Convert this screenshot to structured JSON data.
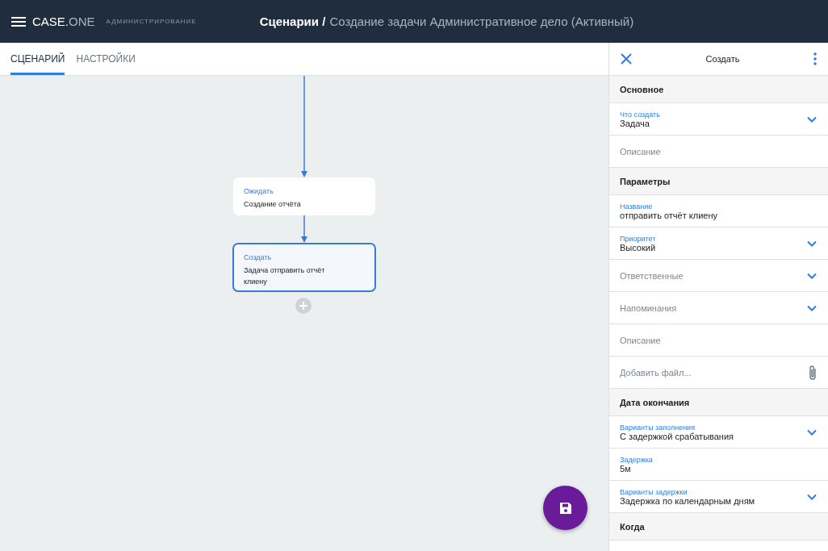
{
  "app_bar": {
    "logo_bold": "CASE.",
    "logo_light": "ONE",
    "subtitle": "АДМИНИСТРИРОВАНИЕ",
    "breadcrumb": "Сценарии /",
    "title": "Создание задачи Административное дело (Активный)"
  },
  "tabs": [
    {
      "label": "СЦЕНАРИЙ",
      "selected": true
    },
    {
      "label": "НАСТРОЙКИ",
      "selected": false
    }
  ],
  "flow": {
    "nodes": [
      {
        "type": "Ожидать",
        "text": "Создание отчёта",
        "selected": false
      },
      {
        "type": "Создать",
        "text": "Задача отправить отчёт клиену",
        "selected": true
      }
    ]
  },
  "panel": {
    "title": "Создать",
    "rows": [
      {
        "kind": "section",
        "label": "Основное"
      },
      {
        "kind": "select",
        "label": "Что создать",
        "value": "Задача"
      },
      {
        "kind": "input",
        "placeholder": "Описание"
      },
      {
        "kind": "section",
        "label": "Параметры"
      },
      {
        "kind": "input",
        "label": "Название",
        "value": "отправить отчёт клиену"
      },
      {
        "kind": "select",
        "label": "Приоритет",
        "value": "Высокий"
      },
      {
        "kind": "select",
        "placeholder": "Ответственные"
      },
      {
        "kind": "select",
        "placeholder": "Напоминания"
      },
      {
        "kind": "input",
        "placeholder": "Описание"
      },
      {
        "kind": "file",
        "placeholder": "Добавить файл..."
      },
      {
        "kind": "section",
        "label": "Дата окончания"
      },
      {
        "kind": "select",
        "label": "Варианты заполнения",
        "value": "С задержкой срабатывания"
      },
      {
        "kind": "input",
        "label": "Задержка",
        "value": "5м"
      },
      {
        "kind": "select",
        "label": "Варианты задержки",
        "value": "Задержка по календарным дням"
      },
      {
        "kind": "section",
        "label": "Когда"
      }
    ]
  }
}
